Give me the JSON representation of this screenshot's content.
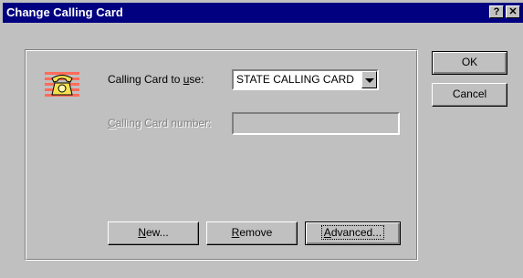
{
  "window": {
    "title": "Change Calling Card",
    "help_label": "?",
    "close_label": "✕"
  },
  "form": {
    "icon": "telephone-icon",
    "calling_card_label_pre": "Calling Card to ",
    "calling_card_label_u": "u",
    "calling_card_label_post": "se:",
    "calling_card_value": "STATE CALLING CARD",
    "card_number_label_u": "C",
    "card_number_label_post": "alling Card number:",
    "card_number_value": ""
  },
  "buttons": {
    "ok": "OK",
    "cancel": "Cancel",
    "new_u": "N",
    "new_post": "ew...",
    "remove_u": "R",
    "remove_post": "emove",
    "advanced_u": "A",
    "advanced_post": "dvanced..."
  },
  "colors": {
    "titlebar": "#000080",
    "face": "#c0c0c0"
  }
}
